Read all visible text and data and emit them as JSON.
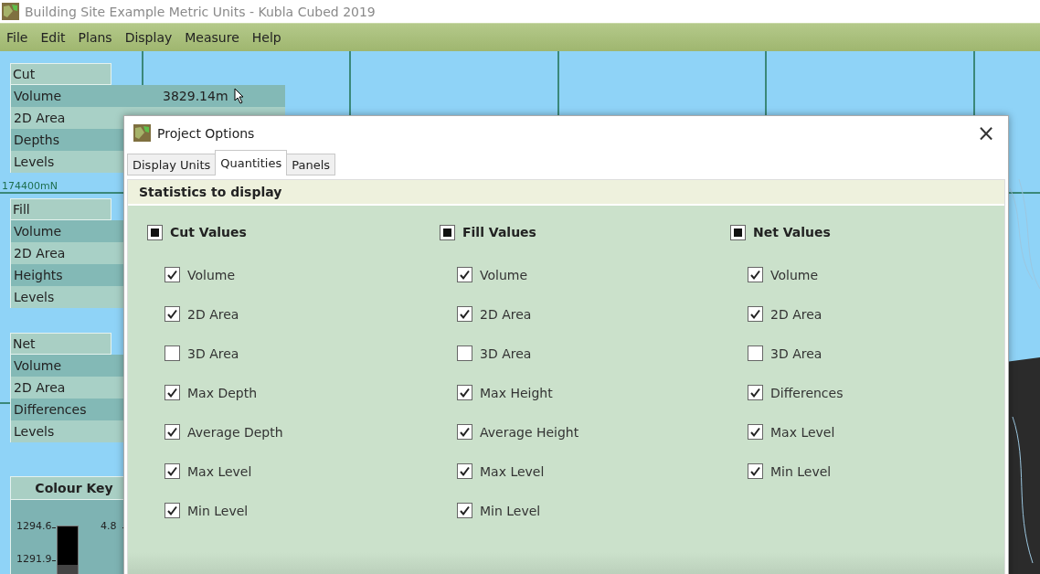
{
  "window": {
    "title": "Building Site Example Metric Units - Kubla Cubed 2019"
  },
  "menu": [
    "File",
    "Edit",
    "Plans",
    "Display",
    "Measure",
    "Help"
  ],
  "map": {
    "coordinate_label": "174400mN"
  },
  "summary_panels": [
    {
      "title": "Cut",
      "rows": [
        {
          "label": "Volume",
          "value": "3829.14m"
        },
        {
          "label": "2D Area"
        },
        {
          "label": "Depths"
        },
        {
          "label": "Levels"
        }
      ]
    },
    {
      "title": "Fill",
      "rows": [
        {
          "label": "Volume"
        },
        {
          "label": "2D Area"
        },
        {
          "label": "Heights"
        },
        {
          "label": "Levels"
        }
      ]
    },
    {
      "title": "Net",
      "rows": [
        {
          "label": "Volume"
        },
        {
          "label": "2D Area"
        },
        {
          "label": "Differences"
        },
        {
          "label": "Levels"
        }
      ]
    }
  ],
  "colour_key": {
    "title": "Colour Key",
    "left_ticks": [
      "1294.6",
      "1291.9"
    ],
    "right_ticks": [
      "4.8"
    ]
  },
  "dialog": {
    "title": "Project Options",
    "close": "×",
    "tabs": [
      {
        "label": "Display Units",
        "selected": false
      },
      {
        "label": "Quantities",
        "selected": true
      },
      {
        "label": "Panels",
        "selected": false
      }
    ],
    "section_title": "Statistics to display",
    "groups": [
      {
        "label": "Cut Values",
        "indeterminate": true,
        "items": [
          {
            "label": "Volume",
            "checked": true
          },
          {
            "label": "2D Area",
            "checked": true
          },
          {
            "label": "3D Area",
            "checked": false
          },
          {
            "label": "Max Depth",
            "checked": true
          },
          {
            "label": "Average Depth",
            "checked": true
          },
          {
            "label": "Max Level",
            "checked": true
          },
          {
            "label": "Min Level",
            "checked": true
          }
        ]
      },
      {
        "label": "Fill Values",
        "indeterminate": true,
        "items": [
          {
            "label": "Volume",
            "checked": true
          },
          {
            "label": "2D Area",
            "checked": true
          },
          {
            "label": "3D Area",
            "checked": false
          },
          {
            "label": "Max Height",
            "checked": true
          },
          {
            "label": "Average Height",
            "checked": true
          },
          {
            "label": "Max Level",
            "checked": true
          },
          {
            "label": "Min Level",
            "checked": true
          }
        ]
      },
      {
        "label": "Net Values",
        "indeterminate": true,
        "items": [
          {
            "label": "Volume",
            "checked": true
          },
          {
            "label": "2D Area",
            "checked": true
          },
          {
            "label": "3D Area",
            "checked": false
          },
          {
            "label": "Differences",
            "checked": true
          },
          {
            "label": "Max Level",
            "checked": true
          },
          {
            "label": "Min Level",
            "checked": true
          }
        ]
      }
    ]
  }
}
